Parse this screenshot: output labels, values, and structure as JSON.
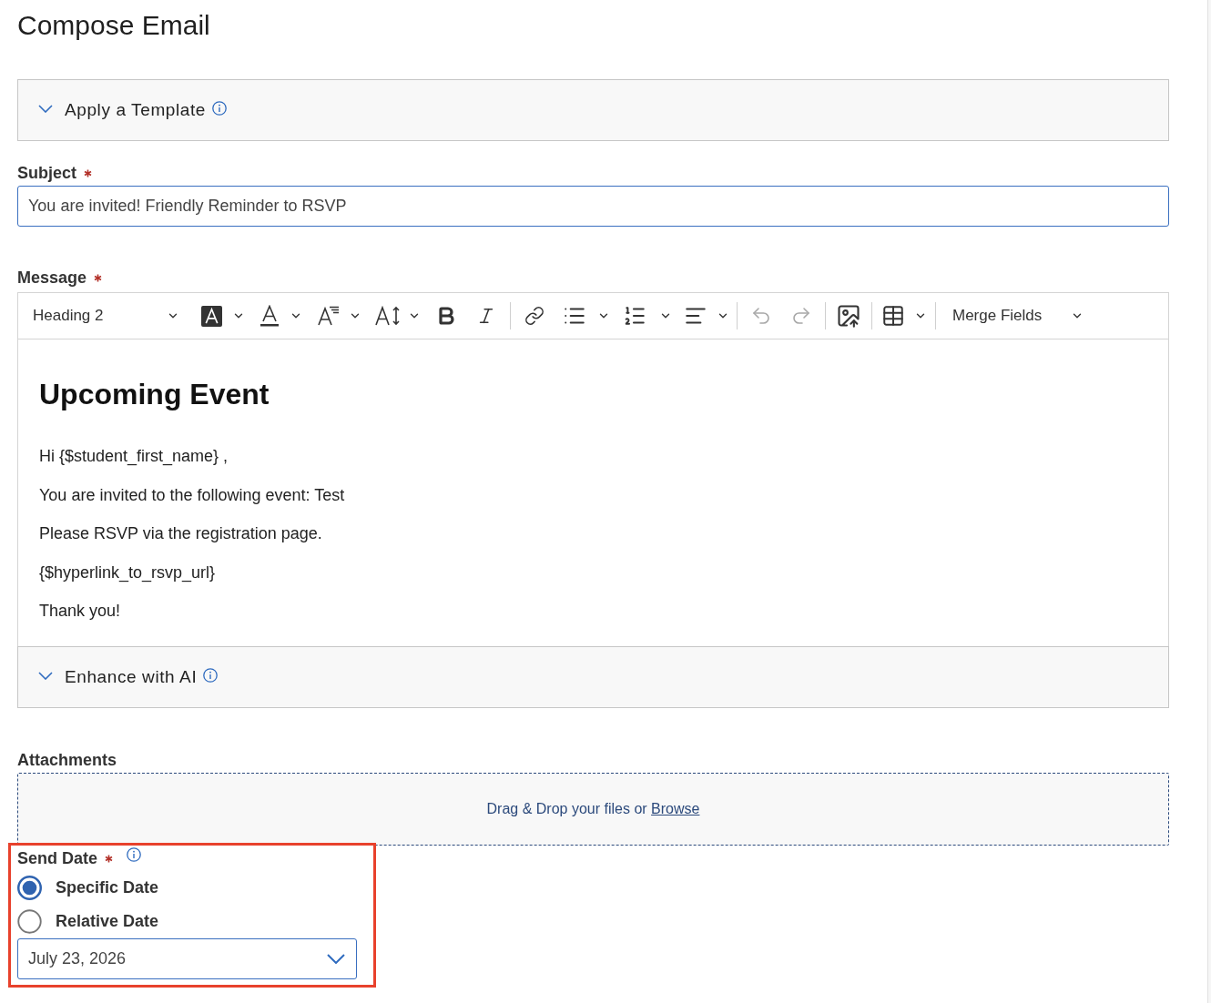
{
  "page": {
    "title": "Compose Email"
  },
  "template_section": {
    "title": "Apply a Template"
  },
  "subject": {
    "label": "Subject",
    "required": true,
    "value": "You are invited! Friendly Reminder to RSVP"
  },
  "message": {
    "label": "Message",
    "required": true,
    "toolbar": {
      "block_style": "Heading 2",
      "undo": {
        "disabled": true
      },
      "redo": {
        "disabled": true
      },
      "merge_fields": "Merge Fields"
    },
    "content": {
      "heading": "Upcoming Event",
      "paragraphs": [
        "Hi {$student_first_name} ,",
        "You are invited to the following event: Test",
        "Please RSVP via the registration page.",
        "{$hyperlink_to_rsvp_url}",
        "Thank you!"
      ]
    }
  },
  "enhance_section": {
    "title": "Enhance with AI"
  },
  "attachments": {
    "label": "Attachments",
    "prompt": "Drag & Drop your files or",
    "link": "Browse"
  },
  "send_date": {
    "label": "Send Date",
    "required": true,
    "highlighted": true,
    "options": [
      {
        "label": "Specific Date",
        "selected": true
      },
      {
        "label": "Relative Date",
        "selected": false
      }
    ],
    "value": "July 23, 2026"
  }
}
